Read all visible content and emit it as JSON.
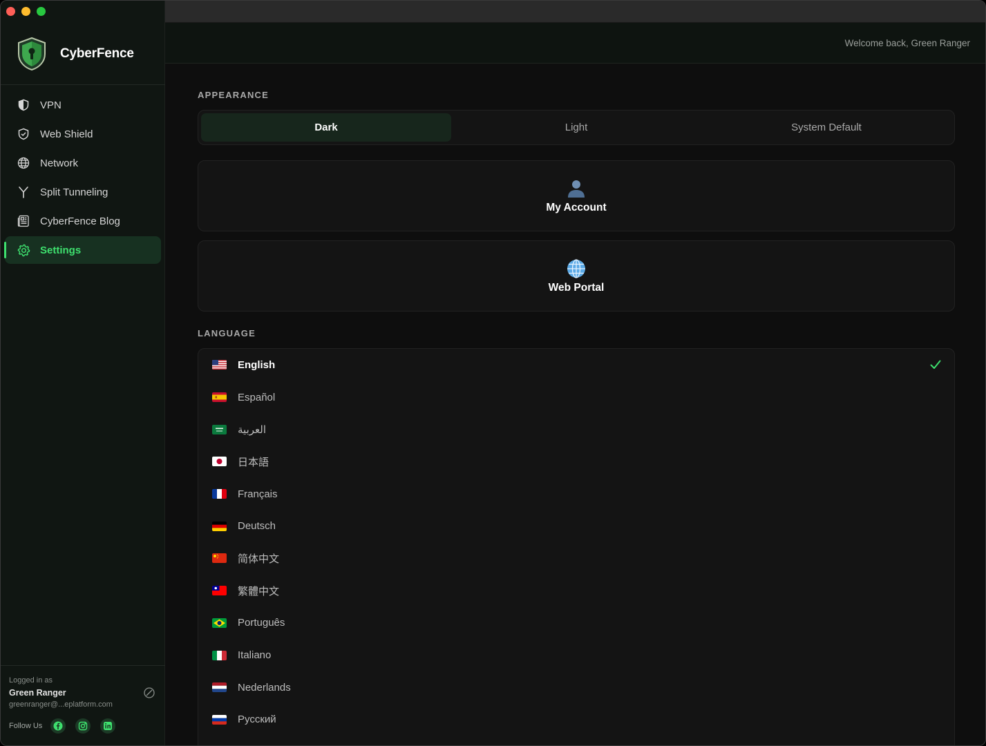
{
  "app": {
    "name": "CyberFence",
    "welcome": "Welcome back, Green Ranger"
  },
  "colors": {
    "accent": "#3ee06e",
    "sidebar_bg": "#101612",
    "content_bg": "#0e0e0e",
    "active_bg": "#173121"
  },
  "sidebar": {
    "items": [
      {
        "label": "VPN",
        "icon": "vpn-shield-icon",
        "active": false
      },
      {
        "label": "Web Shield",
        "icon": "web-shield-icon",
        "active": false
      },
      {
        "label": "Network",
        "icon": "globe-icon",
        "active": false
      },
      {
        "label": "Split Tunneling",
        "icon": "split-icon",
        "active": false
      },
      {
        "label": "CyberFence Blog",
        "icon": "newspaper-icon",
        "active": false
      },
      {
        "label": "Settings",
        "icon": "gear-icon",
        "active": true
      }
    ],
    "footer": {
      "logged_in_label": "Logged in as",
      "user_name": "Green Ranger",
      "email": "greenranger@...eplatform.com",
      "follow_label": "Follow Us"
    }
  },
  "appearance": {
    "title": "APPEARANCE",
    "options": [
      "Dark",
      "Light",
      "System Default"
    ],
    "selected": "Dark"
  },
  "cards": {
    "account": {
      "label": "My Account",
      "icon": "user-icon"
    },
    "portal": {
      "label": "Web Portal",
      "icon": "globe-icon"
    }
  },
  "language": {
    "title": "LANGUAGE",
    "selected": "English",
    "items": [
      {
        "label": "English",
        "flag": "us-flag-icon"
      },
      {
        "label": "Español",
        "flag": "es-flag-icon"
      },
      {
        "label": "العربية",
        "flag": "sa-flag-icon"
      },
      {
        "label": "日本語",
        "flag": "jp-flag-icon"
      },
      {
        "label": "Français",
        "flag": "fr-flag-icon"
      },
      {
        "label": "Deutsch",
        "flag": "de-flag-icon"
      },
      {
        "label": "简体中文",
        "flag": "cn-flag-icon"
      },
      {
        "label": "繁體中文",
        "flag": "tw-flag-icon"
      },
      {
        "label": "Português",
        "flag": "br-flag-icon"
      },
      {
        "label": "Italiano",
        "flag": "it-flag-icon"
      },
      {
        "label": "Nederlands",
        "flag": "nl-flag-icon"
      },
      {
        "label": "Русский",
        "flag": "ru-flag-icon"
      }
    ]
  }
}
